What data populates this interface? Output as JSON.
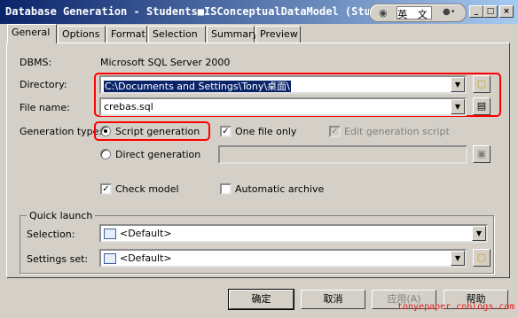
{
  "window": {
    "title": "Database Generation - Students■ISConceptualDataModel (Stud",
    "ime_label": "英 文",
    "minimize": "_",
    "maximize": "□",
    "close": "×"
  },
  "tabs": [
    {
      "label": "General",
      "active": true
    },
    {
      "label": "Options"
    },
    {
      "label": "Format"
    },
    {
      "label": "Selection"
    },
    {
      "label": "Summary"
    },
    {
      "label": "Preview"
    }
  ],
  "general": {
    "dbms_label": "DBMS:",
    "dbms_value": "Microsoft SQL Server 2000",
    "directory_label": "Directory:",
    "directory_value": "C:\\Documents and Settings\\Tony\\桌面\\",
    "filename_label": "File name:",
    "filename_value": "crebas.sql",
    "gentype_label": "Generation type:",
    "script_generation": "Script generation",
    "one_file_only": "One file only",
    "edit_generation_script": "Edit generation script",
    "direct_generation": "Direct generation",
    "check_model": "Check model",
    "automatic_archive": "Automatic archive"
  },
  "quick_launch": {
    "title": "Quick launch",
    "selection_label": "Selection:",
    "selection_value": "<Default>",
    "settings_label": "Settings set:",
    "settings_value": "<Default>"
  },
  "buttons": {
    "ok": "确定",
    "cancel": "取消",
    "apply": "应用(A)",
    "help": "帮助"
  },
  "watermark": "tonyepaper.cnblogs.com",
  "colors": {
    "title_start": "#0a246a",
    "title_end": "#a6caf0",
    "highlight": "#ff0000",
    "selection_bg": "#0a246a"
  }
}
